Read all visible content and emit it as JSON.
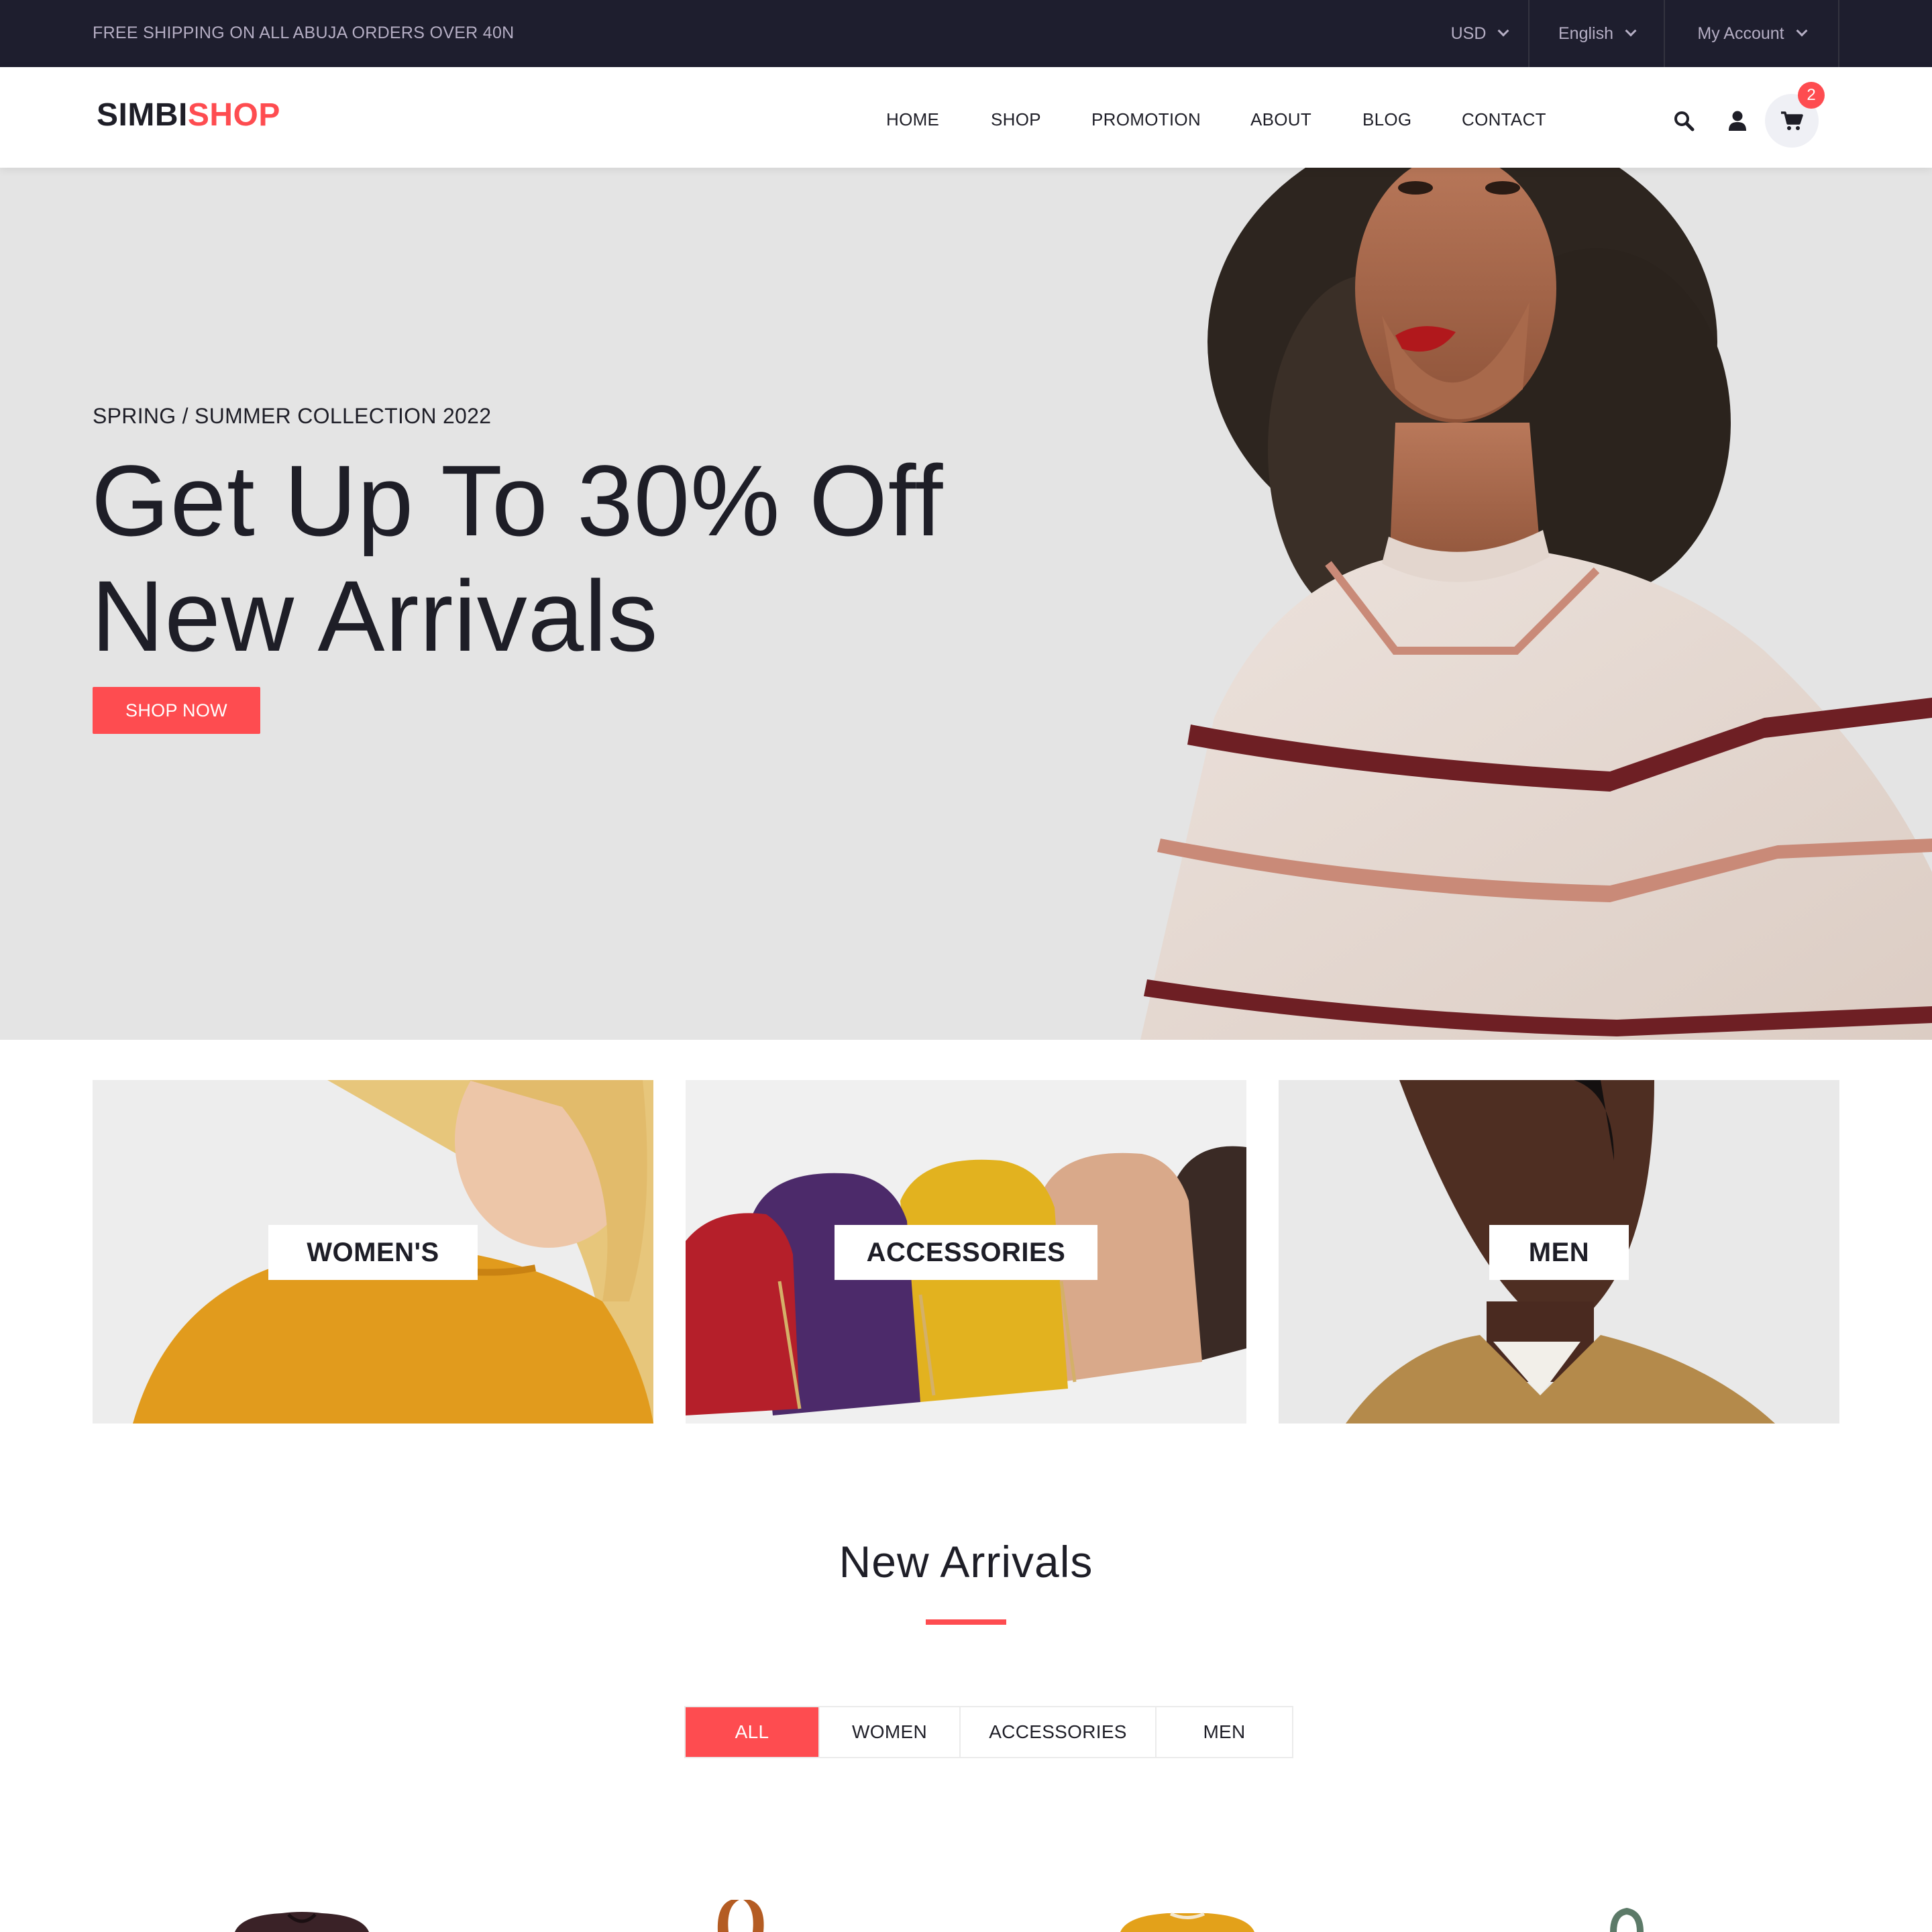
{
  "topbar": {
    "promo": "FREE SHIPPING ON ALL ABUJA ORDERS OVER 40N",
    "currency": "USD",
    "language": "English",
    "account": "My Account"
  },
  "header": {
    "logo_part1": "SIMBI",
    "logo_part2": "SHOP",
    "nav": [
      "HOME",
      "SHOP",
      "PROMOTION",
      "ABOUT",
      "BLOG",
      "CONTACT"
    ],
    "cart_count": "2"
  },
  "hero": {
    "subtitle": "SPRING / SUMMER COLLECTION 2022",
    "headline_line1": "Get Up To 30% Off",
    "headline_line2": "New Arrivals",
    "button": "SHOP NOW"
  },
  "banners": [
    "WOMEN'S",
    "ACCESSORIES",
    "MEN"
  ],
  "new_arrivals": {
    "title": "New Arrivals",
    "filters": [
      "ALL",
      "WOMEN",
      "ACCESSORIES",
      "MEN"
    ],
    "active_filter": "ALL"
  },
  "colors": {
    "accent": "#fe4c50",
    "topbar_bg": "#1e1e2e",
    "text_dark": "#1e1e27"
  },
  "icons": [
    "chevron-down-icon",
    "search-icon",
    "user-icon",
    "cart-icon"
  ]
}
